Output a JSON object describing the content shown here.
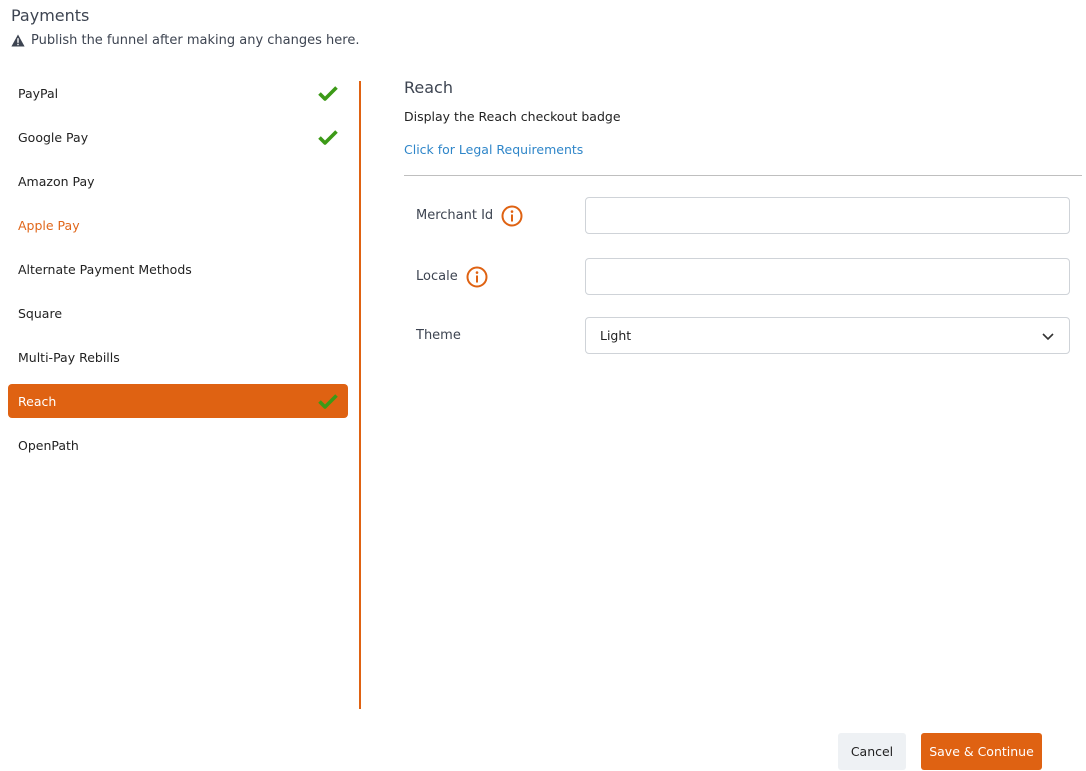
{
  "header": {
    "title": "Payments",
    "warning_text": "Publish the funnel after making any changes here."
  },
  "sidebar": {
    "items": [
      {
        "label": "PayPal",
        "checked": true,
        "state": "normal"
      },
      {
        "label": "Google Pay",
        "checked": true,
        "state": "normal"
      },
      {
        "label": "Amazon Pay",
        "checked": false,
        "state": "normal"
      },
      {
        "label": "Apple Pay",
        "checked": false,
        "state": "warning"
      },
      {
        "label": "Alternate Payment Methods",
        "checked": false,
        "state": "normal"
      },
      {
        "label": "Square",
        "checked": false,
        "state": "normal"
      },
      {
        "label": "Multi-Pay Rebills",
        "checked": false,
        "state": "normal"
      },
      {
        "label": "Reach",
        "checked": true,
        "state": "active"
      },
      {
        "label": "OpenPath",
        "checked": false,
        "state": "normal"
      }
    ]
  },
  "main": {
    "title": "Reach",
    "description": "Display the Reach checkout badge",
    "legal_link": "Click for Legal Requirements",
    "form": {
      "merchant_id": {
        "label": "Merchant Id",
        "value": "",
        "info_icon": "info-circle-icon"
      },
      "locale": {
        "label": "Locale",
        "value": "",
        "info_icon": "info-circle-icon"
      },
      "theme": {
        "label": "Theme",
        "value": "Light"
      }
    }
  },
  "footer": {
    "cancel_label": "Cancel",
    "save_label": "Save & Continue"
  },
  "colors": {
    "accent": "#df6212",
    "check": "#3c9a17",
    "link": "#2f86c9"
  }
}
